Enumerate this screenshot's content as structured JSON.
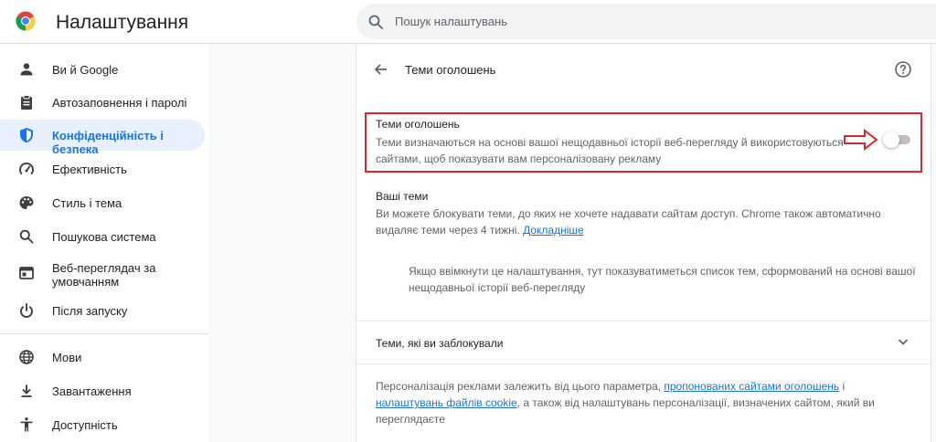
{
  "header": {
    "title": "Налаштування",
    "search_placeholder": "Пошук налаштувань"
  },
  "sidebar": {
    "items": [
      {
        "label": "Ви й Google",
        "icon": "person-icon"
      },
      {
        "label": "Автозаповнення і паролі",
        "icon": "clipboard-icon"
      },
      {
        "label": "Конфіденційність і безпека",
        "icon": "shield-icon",
        "active": true
      },
      {
        "label": "Ефективність",
        "icon": "speedometer-icon"
      },
      {
        "label": "Стиль і тема",
        "icon": "palette-icon"
      },
      {
        "label": "Пошукова система",
        "icon": "search-icon"
      },
      {
        "label": "Веб-переглядач за умовчанням",
        "icon": "browser-window-icon"
      },
      {
        "label": "Після запуску",
        "icon": "power-icon"
      },
      {
        "label": "Мови",
        "icon": "globe-icon"
      },
      {
        "label": "Завантаження",
        "icon": "download-icon"
      },
      {
        "label": "Доступність",
        "icon": "accessibility-icon"
      }
    ]
  },
  "main": {
    "title": "Теми оголошень",
    "ad_topics": {
      "title": "Теми оголошень",
      "description": "Теми визначаються на основі вашої нещодавньої історії веб-перегляду й використовуються сайтами, щоб показувати вам персоналізовану рекламу",
      "toggle_on": false
    },
    "your_topics": {
      "title": "Ваші теми",
      "description": "Ви можете блокувати теми, до яких не хочете надавати сайтам доступ. Chrome також автоматично видаляє теми через 4 тижні. ",
      "learn_more": "Докладніше"
    },
    "empty_note": "Якщо ввімкнути це налаштування, тут показуватиметься список тем, сформований на основі вашої нещодавньої історії веб-перегляду",
    "blocked_label": "Теми, які ви заблокували",
    "footer": {
      "text_1": "Персоналізація реклами залежить від цього параметра, ",
      "link_1": "пропонованих сайтами оголошень",
      "text_2": " і ",
      "link_2": "налаштувань файлів cookie",
      "text_3": ", а також від налаштувань персоналізації, визначених сайтом, який ви переглядаєте"
    }
  },
  "colors": {
    "accent": "#1a73e8",
    "active_bg": "#e8f0fe",
    "highlight": "#e0242b"
  }
}
